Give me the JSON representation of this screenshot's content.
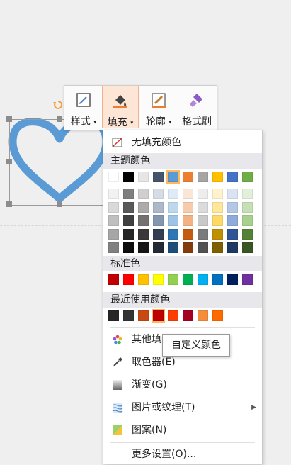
{
  "toolbar": {
    "style_label": "样式",
    "fill_label": "填充",
    "outline_label": "轮廓",
    "painter_label": "格式刷"
  },
  "menu": {
    "no_fill": "无填充颜色",
    "theme_colors_header": "主题颜色",
    "standard_colors_header": "标准色",
    "recent_colors_header": "最近使用颜色",
    "other_colors": "其他填",
    "eyedropper": "取色器(E)",
    "gradient": "渐变(G)",
    "picture_texture": "图片或纹理(T)",
    "pattern": "图案(N)",
    "more_settings": "更多设置(O)..."
  },
  "tooltip": {
    "text": "自定义颜色"
  },
  "colors": {
    "heart_stroke": "#5b9bd5",
    "theme_top": [
      "#ffffff",
      "#000000",
      "#e7e6e6",
      "#44546a",
      "#5b9bd5",
      "#ed7d31",
      "#a5a5a5",
      "#ffc000",
      "#4472c4",
      "#70ad47"
    ],
    "theme_shades": [
      [
        "#f2f2f2",
        "#d9d9d9",
        "#bfbfbf",
        "#a6a6a6",
        "#808080"
      ],
      [
        "#7f7f7f",
        "#595959",
        "#404040",
        "#262626",
        "#0d0d0d"
      ],
      [
        "#d0cece",
        "#aeaaaa",
        "#757171",
        "#3a3838",
        "#171616"
      ],
      [
        "#d6dce5",
        "#adb9ca",
        "#8497b0",
        "#333f50",
        "#222a35"
      ],
      [
        "#deebf7",
        "#bdd7ee",
        "#9dc3e6",
        "#2e75b6",
        "#1f4e79"
      ],
      [
        "#fbe5d6",
        "#f8cbad",
        "#f4b183",
        "#c55a11",
        "#843c0c"
      ],
      [
        "#ededed",
        "#dbdbdb",
        "#c9c9c9",
        "#7b7b7b",
        "#525252"
      ],
      [
        "#fff2cc",
        "#ffe699",
        "#ffd966",
        "#bf9000",
        "#7f6000"
      ],
      [
        "#dae3f3",
        "#b4c7e7",
        "#8faadc",
        "#2f5597",
        "#203864"
      ],
      [
        "#e2f0d9",
        "#c5e0b4",
        "#a9d18e",
        "#548235",
        "#385723"
      ]
    ],
    "standard": [
      "#c00000",
      "#ff0000",
      "#ffc000",
      "#ffff00",
      "#92d050",
      "#00b050",
      "#00b0f0",
      "#0070c0",
      "#002060",
      "#7030a0"
    ],
    "recent": [
      "#262626",
      "#333333",
      "#c84a12",
      "#c00000",
      "#ff3d00",
      "#a50021",
      "#f58d3c",
      "#ff6a00"
    ]
  }
}
